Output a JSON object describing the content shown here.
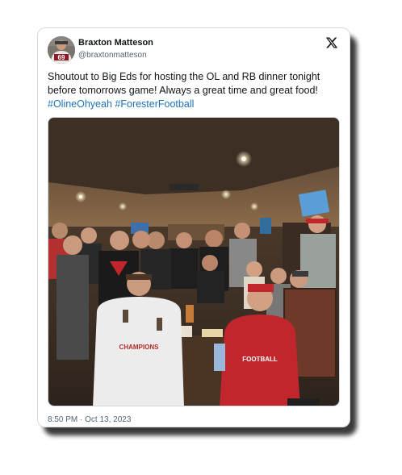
{
  "author": {
    "display_name": "Braxton Matteson",
    "handle": "@braxtonmatteson",
    "avatar_jersey_number": "69"
  },
  "tweet": {
    "text": "Shoutout to Big Eds for hosting the OL and RB dinner tonight before tomorrows game! Always a great time and great food! ",
    "hashtags": [
      "#OlineOhyeah",
      "#ForesterFootball"
    ],
    "timestamp": "8:50 PM · Oct 13, 2023"
  },
  "photo": {
    "shirt_text_left": "CHAMPIONS",
    "shirt_text_right": "FOOTBALL"
  },
  "icons": {
    "platform_logo": "x-logo-icon"
  },
  "colors": {
    "hashtag": "#1d72b8",
    "text_primary": "#0f1419",
    "text_secondary": "#536471"
  }
}
